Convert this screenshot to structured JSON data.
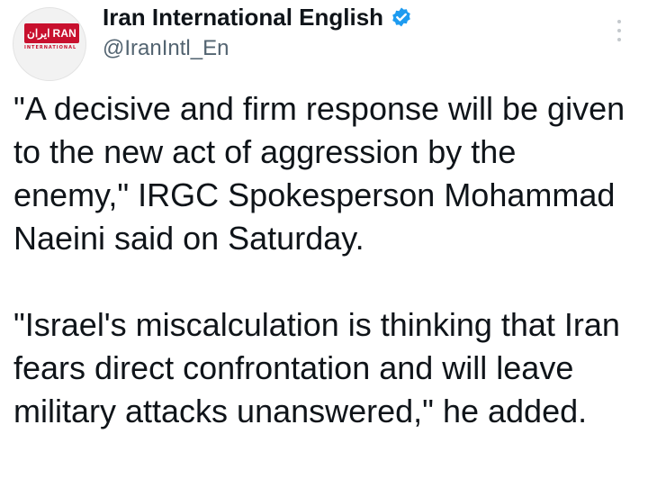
{
  "account": {
    "display_name": "Iran International English",
    "handle": "@IranIntl_En",
    "verified": true,
    "avatar_logo": {
      "fa": "ایران",
      "en": "RAN",
      "sub": "INTERNATIONAL"
    }
  },
  "icons": {
    "verified": "verified-badge-icon",
    "more": "more-options-icon"
  },
  "colors": {
    "verified": "#1d9bf0",
    "brand_red": "#c8102e",
    "text": "#0f1419",
    "secondary_text": "#536471"
  },
  "tweet": {
    "paragraph_1": "\"A decisive and firm response will be given to the new act of aggression by the enemy,\" IRGC Spokesperson Mohammad Naeini said on Saturday.",
    "paragraph_2": "\"Israel's miscalculation is thinking that Iran fears direct confrontation and will leave military attacks unanswered,\" he added."
  }
}
